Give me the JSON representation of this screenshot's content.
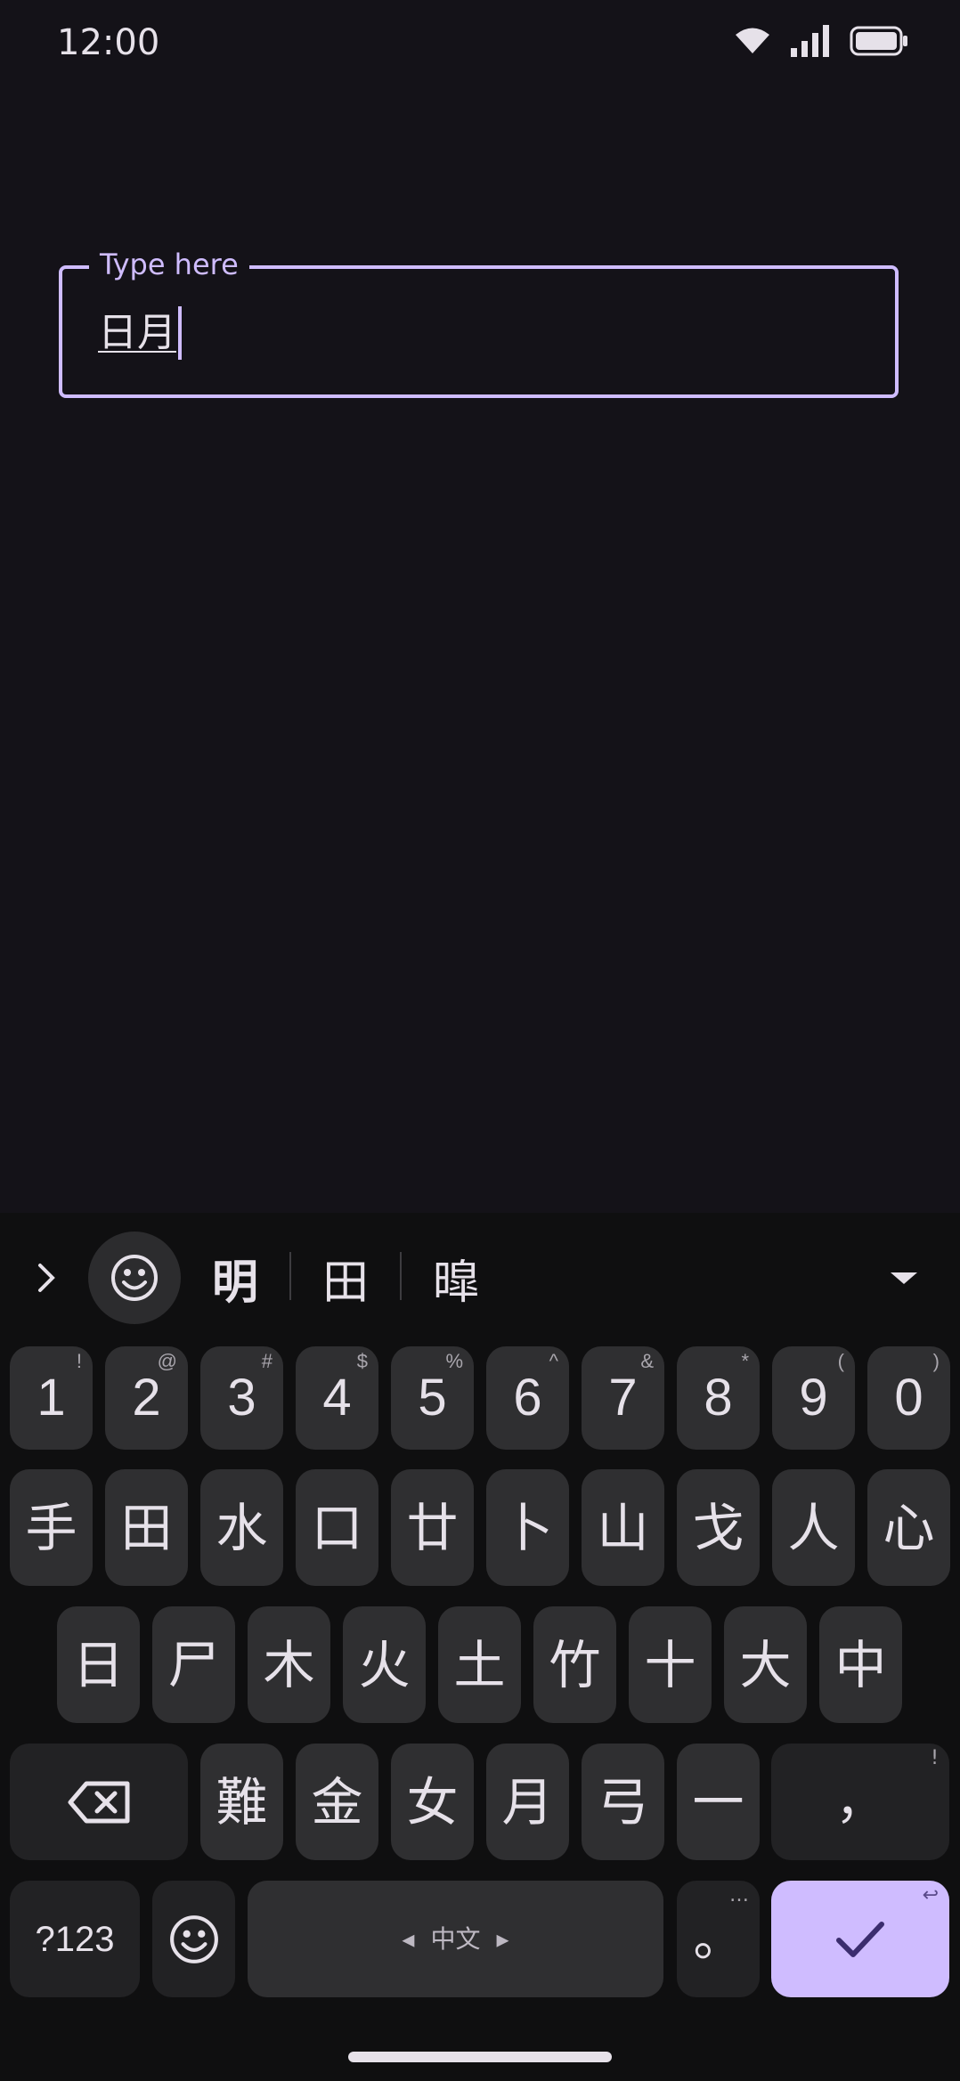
{
  "status_bar": {
    "time": "12:00",
    "icons": [
      "wifi-icon",
      "signal-icon",
      "battery-icon"
    ]
  },
  "text_field": {
    "label": "Type here",
    "value": "日月",
    "accent": "#cfbcff"
  },
  "suggestions": {
    "candidates": [
      "明",
      "田",
      "暭"
    ]
  },
  "keyboard": {
    "number_row": [
      {
        "label": "1",
        "hint": "!"
      },
      {
        "label": "2",
        "hint": "@"
      },
      {
        "label": "3",
        "hint": "#"
      },
      {
        "label": "4",
        "hint": "$"
      },
      {
        "label": "5",
        "hint": "%"
      },
      {
        "label": "6",
        "hint": "^"
      },
      {
        "label": "7",
        "hint": "&"
      },
      {
        "label": "8",
        "hint": "*"
      },
      {
        "label": "9",
        "hint": "("
      },
      {
        "label": "0",
        "hint": ")"
      }
    ],
    "row2": [
      "手",
      "田",
      "水",
      "口",
      "廿",
      "卜",
      "山",
      "戈",
      "人",
      "心"
    ],
    "row3": [
      "日",
      "尸",
      "木",
      "火",
      "土",
      "竹",
      "十",
      "大",
      "中"
    ],
    "row4": [
      "難",
      "金",
      "女",
      "月",
      "弓",
      "一"
    ],
    "comma": {
      "label": "，",
      "hint": "!"
    },
    "symbols_label": "?123",
    "space_label": "中文",
    "period": {
      "label": "。",
      "hint": "…"
    },
    "enter_hint": "↩",
    "enter_color": "#cfbcff"
  }
}
